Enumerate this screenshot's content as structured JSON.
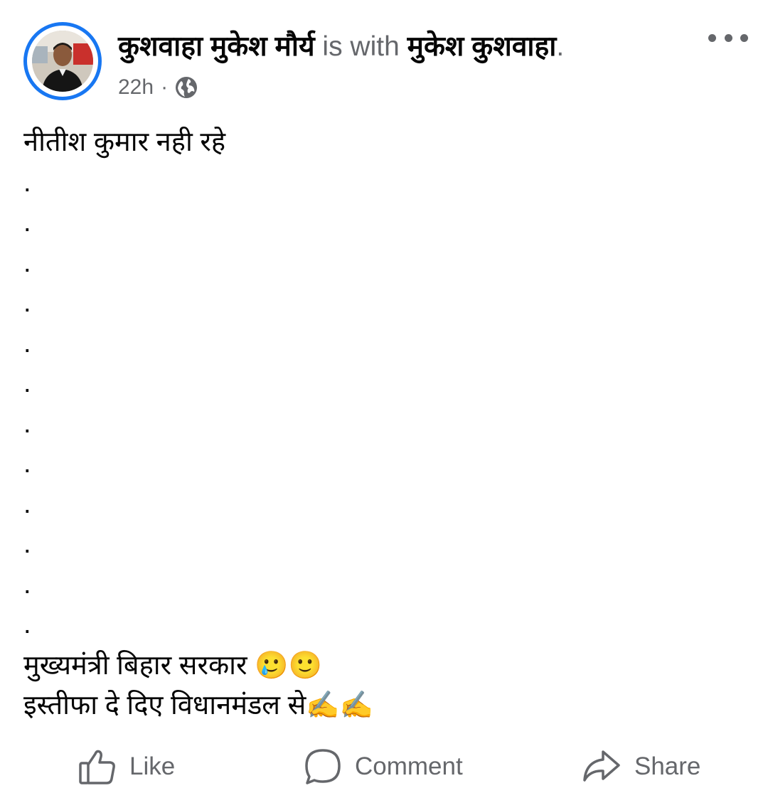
{
  "post": {
    "author": "कुशवाहा मुकेश मौर्य",
    "with_text": "is with",
    "tagged": "मुकेश कुशवाहा",
    "period": ".",
    "time": "22h",
    "meta_separator": "·",
    "privacy_icon": "globe-icon",
    "more_icon": "more-options-icon",
    "body": {
      "first_line": "नीतीश कुमार नही रहे",
      "dot_lines": [
        ".",
        ".",
        ".",
        ".",
        ".",
        ".",
        ".",
        ".",
        ".",
        ".",
        ".",
        "."
      ],
      "line2_text": "मुख्यमंत्री बिहार सरकार ",
      "line2_emoji": "🥲🙂",
      "line3_text": "इस्तीफा दे दिए विधानमंडल से",
      "line3_emoji": "✍️✍️"
    }
  },
  "actions": {
    "like": {
      "label": "Like",
      "icon": "thumbs-up-icon"
    },
    "comment": {
      "label": "Comment",
      "icon": "comment-bubble-icon"
    },
    "share": {
      "label": "Share",
      "icon": "share-arrow-icon"
    }
  },
  "colors": {
    "accent": "#1877f2",
    "secondary_text": "#65676b",
    "primary_text": "#050505"
  }
}
